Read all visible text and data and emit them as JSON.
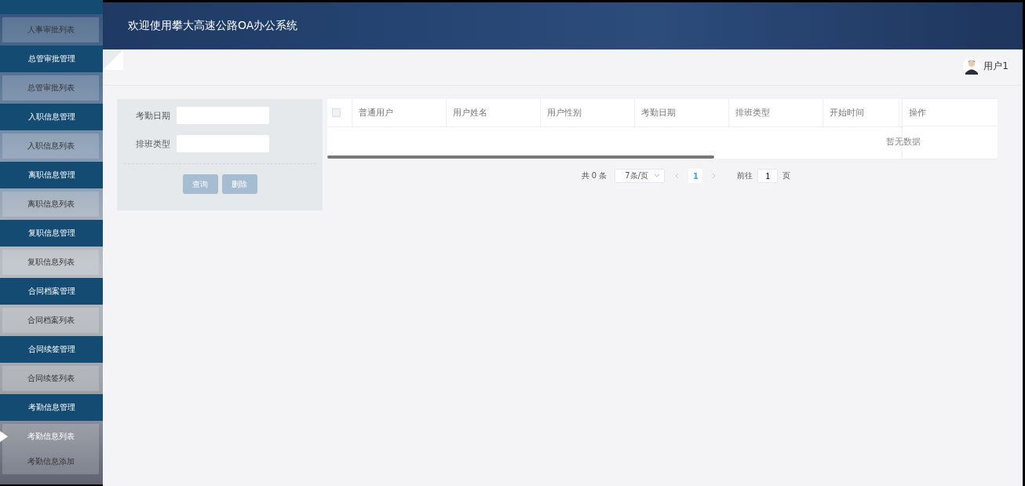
{
  "header": {
    "title": "欢迎使用攀大高速公路OA办公系统"
  },
  "user": {
    "name": "用户1"
  },
  "sidebar": {
    "sections": [
      {
        "items": [
          {
            "label": "人事审批列表",
            "selected": false
          }
        ]
      },
      {
        "title": "总管审批管理",
        "items": [
          {
            "label": "总管审批列表",
            "selected": false
          }
        ]
      },
      {
        "title": "入职信息管理",
        "items": [
          {
            "label": "入职信息列表",
            "selected": false
          }
        ]
      },
      {
        "title": "离职信息管理",
        "items": [
          {
            "label": "离职信息列表",
            "selected": false
          }
        ]
      },
      {
        "title": "复职信息管理",
        "items": [
          {
            "label": "复职信息列表",
            "selected": false
          }
        ]
      },
      {
        "title": "合同档案管理",
        "items": [
          {
            "label": "合同档案列表",
            "selected": false
          }
        ]
      },
      {
        "title": "合同续签管理",
        "items": [
          {
            "label": "合同续签列表",
            "selected": false
          }
        ]
      },
      {
        "title": "考勤信息管理",
        "items": [
          {
            "label": "考勤信息列表",
            "selected": true
          },
          {
            "label": "考勤信息添加",
            "selected": false
          }
        ]
      }
    ]
  },
  "search": {
    "fields": [
      {
        "label": "考勤日期"
      },
      {
        "label": "排班类型"
      }
    ],
    "buttons": [
      "查询",
      "删除"
    ]
  },
  "table": {
    "select_all": {
      "checked": false
    },
    "columns": [
      "普通用户",
      "用户姓名",
      "用户性别",
      "考勤日期",
      "排班类型",
      "开始时间"
    ],
    "action_column": "操作",
    "empty_text": "暂无数据"
  },
  "pagination": {
    "total": "共 0 条",
    "page_size": "7条/页",
    "current": "1",
    "goto_label": "前往",
    "goto_value": "1",
    "page_unit": "页"
  }
}
